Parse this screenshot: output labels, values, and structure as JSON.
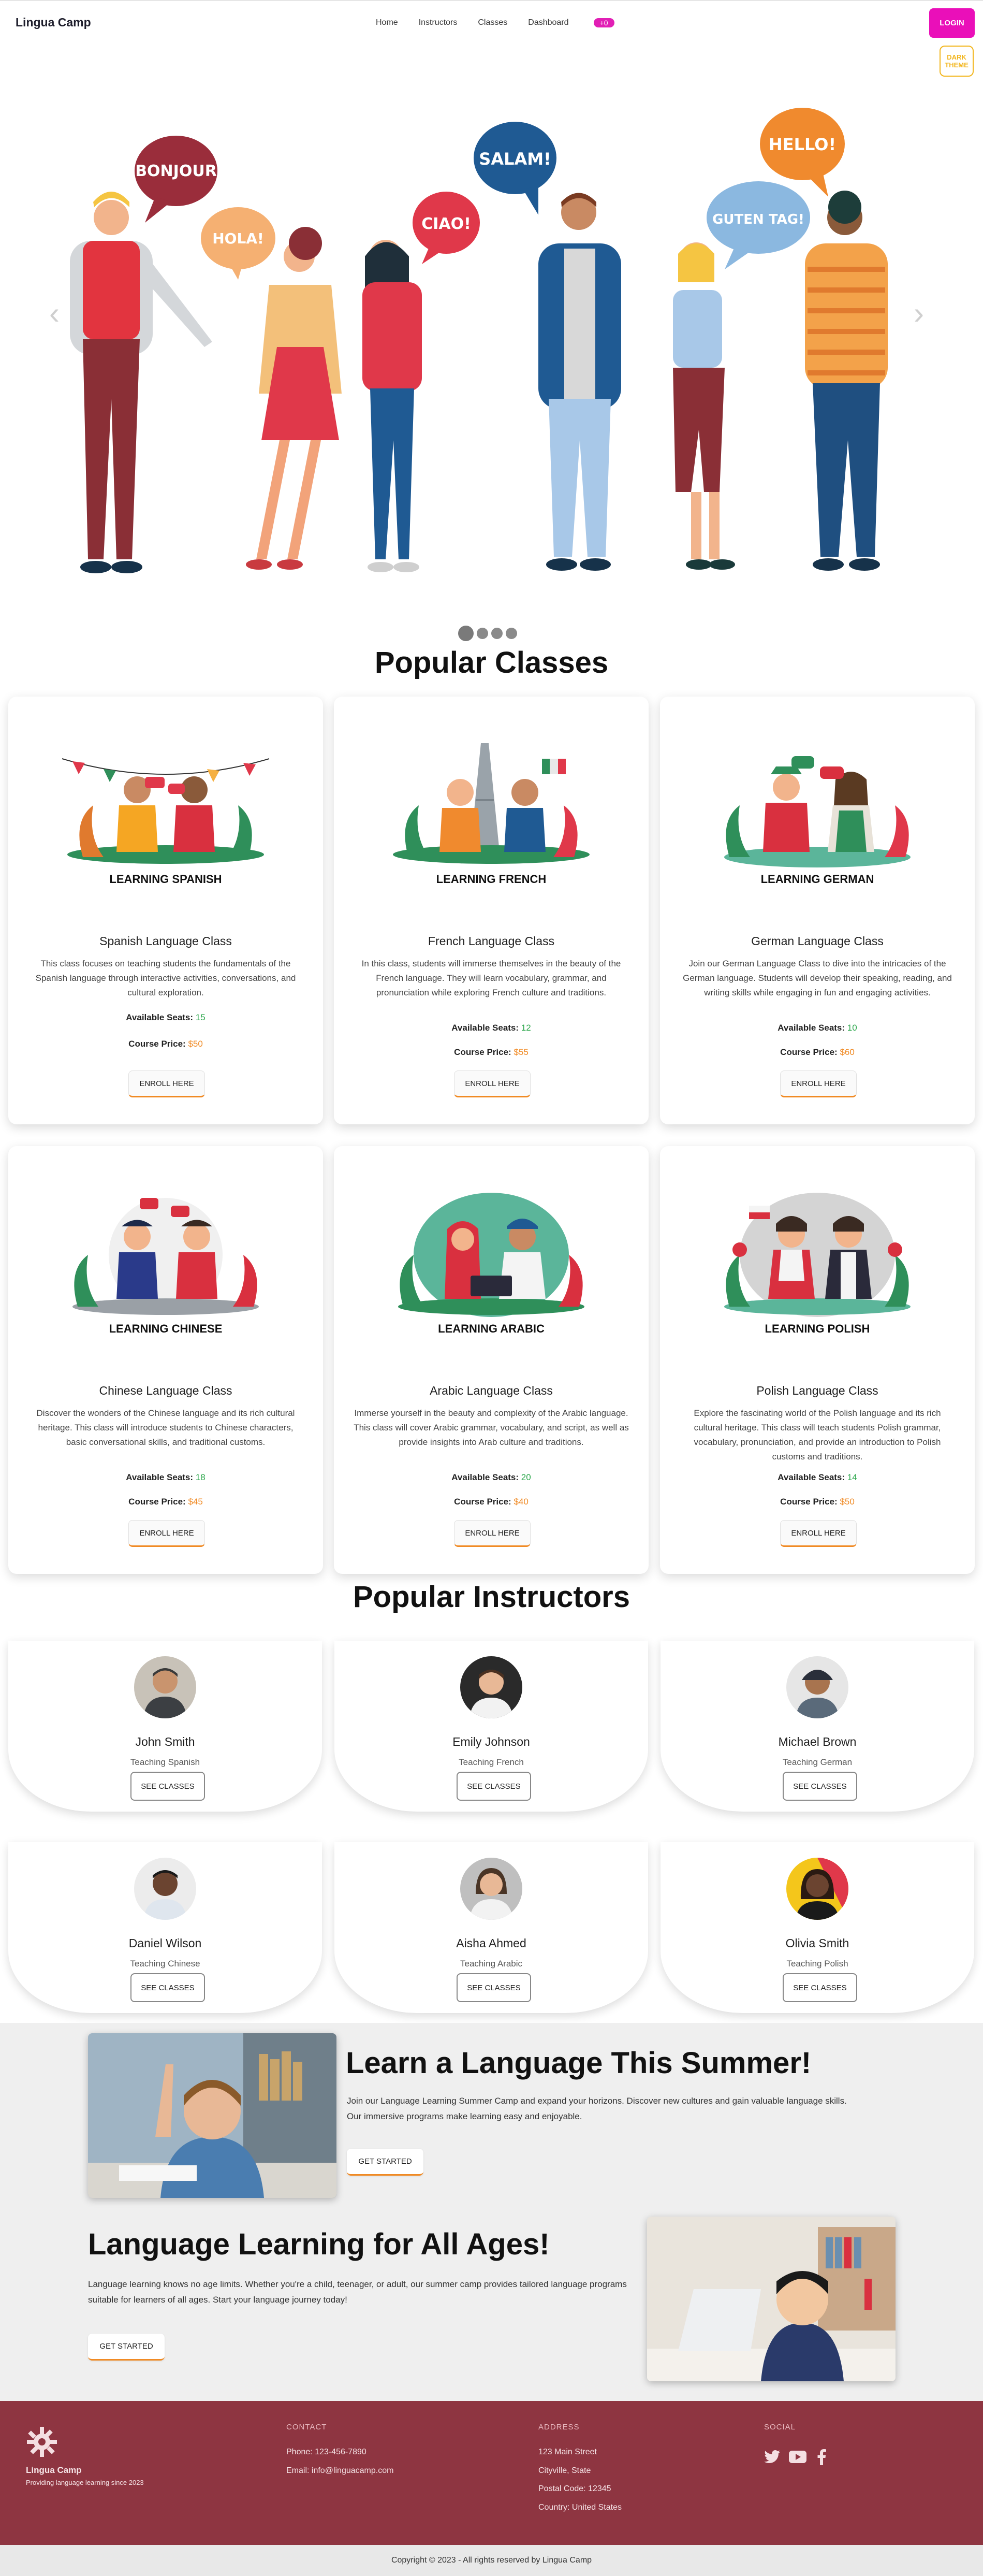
{
  "nav": {
    "brand": "Lingua Camp",
    "links": [
      "Home",
      "Instructors",
      "Classes",
      "Dashboard"
    ],
    "dashboard_badge": "+0",
    "login": "LOGIN",
    "theme_toggle": "DARK THEME"
  },
  "hero": {
    "bubbles": [
      "BONJOUR",
      "HOLA!",
      "CIAO!",
      "SALAM!",
      "GUTEN TAG!",
      "HELLO!"
    ],
    "active_slide": 1,
    "slides": 4
  },
  "classes": {
    "title": "Popular Classes",
    "items": [
      {
        "illus_label": "LEARNING SPANISH",
        "title": "Spanish Language Class",
        "desc": "This class focuses on teaching students the fundamentals of the Spanish language through interactive activities, conversations, and cultural exploration.",
        "seats_label": "Available Seats:",
        "seats": "15",
        "price_label": "Course Price:",
        "price": "$50",
        "button": "ENROLL HERE"
      },
      {
        "illus_label": "LEARNING FRENCH",
        "title": "French Language Class",
        "desc": "In this class, students will immerse themselves in the beauty of the French language. They will learn vocabulary, grammar, and pronunciation while exploring French culture and traditions.",
        "seats_label": "Available Seats:",
        "seats": "12",
        "price_label": "Course Price:",
        "price": "$55",
        "button": "ENROLL HERE"
      },
      {
        "illus_label": "LEARNING GERMAN",
        "title": "German Language Class",
        "desc": "Join our German Language Class to dive into the intricacies of the German language. Students will develop their speaking, reading, and writing skills while engaging in fun and engaging activities.",
        "seats_label": "Available Seats:",
        "seats": "10",
        "price_label": "Course Price:",
        "price": "$60",
        "button": "ENROLL HERE"
      },
      {
        "illus_label": "LEARNING CHINESE",
        "title": "Chinese Language Class",
        "desc": "Discover the wonders of the Chinese language and its rich cultural heritage. This class will introduce students to Chinese characters, basic conversational skills, and traditional customs.",
        "seats_label": "Available Seats:",
        "seats": "18",
        "price_label": "Course Price:",
        "price": "$45",
        "button": "ENROLL HERE"
      },
      {
        "illus_label": "LEARNING ARABIC",
        "title": "Arabic Language Class",
        "desc": "Immerse yourself in the beauty and complexity of the Arabic language. This class will cover Arabic grammar, vocabulary, and script, as well as provide insights into Arab culture and traditions.",
        "seats_label": "Available Seats:",
        "seats": "20",
        "price_label": "Course Price:",
        "price": "$40",
        "button": "ENROLL HERE"
      },
      {
        "illus_label": "LEARNING POLISH",
        "title": "Polish Language Class",
        "desc": "Explore the fascinating world of the Polish language and its rich cultural heritage. This class will teach students Polish grammar, vocabulary, pronunciation, and provide an introduction to Polish customs and traditions.",
        "seats_label": "Available Seats:",
        "seats": "14",
        "price_label": "Course Price:",
        "price": "$50",
        "button": "ENROLL HERE"
      }
    ]
  },
  "instructors": {
    "title": "Popular Instructors",
    "items": [
      {
        "name": "John Smith",
        "sub": "Teaching Spanish",
        "button": "SEE CLASSES"
      },
      {
        "name": "Emily Johnson",
        "sub": "Teaching French",
        "button": "SEE CLASSES"
      },
      {
        "name": "Michael Brown",
        "sub": "Teaching German",
        "button": "SEE CLASSES"
      },
      {
        "name": "Daniel Wilson",
        "sub": "Teaching Chinese",
        "button": "SEE CLASSES"
      },
      {
        "name": "Aisha Ahmed",
        "sub": "Teaching Arabic",
        "button": "SEE CLASSES"
      },
      {
        "name": "Olivia Smith",
        "sub": "Teaching Polish",
        "button": "SEE CLASSES"
      }
    ]
  },
  "promo": {
    "one": {
      "title": "Learn a Language This Summer!",
      "body": "Join our Language Learning Summer Camp and expand your horizons. Discover new cultures and gain valuable language skills. Our immersive programs make learning easy and enjoyable.",
      "button": "GET STARTED"
    },
    "two": {
      "title": "Language Learning for All Ages!",
      "body": "Language learning knows no age limits. Whether you're a child, teenager, or adult, our summer camp provides tailored language programs suitable for learners of all ages. Start your language journey today!",
      "button": "GET STARTED"
    }
  },
  "footer": {
    "brand": "Lingua Camp",
    "tagline": "Providing language learning since 2023",
    "contact_h": "CONTACT",
    "phone": "Phone: 123-456-7890",
    "email": "Email: info@linguacamp.com",
    "address_h": "ADDRESS",
    "addr1": "123 Main Street",
    "addr2": "Cityville, State",
    "addr3": "Postal Code: 12345",
    "addr4": "Country: United States",
    "social_h": "SOCIAL",
    "copyright": "Copyright © 2023 - All rights reserved by Lingua Camp"
  },
  "colors": {
    "accent": "#ea0fb9",
    "orange": "#f08a24",
    "footer": "#8e3541",
    "green": "#2aa64a"
  }
}
